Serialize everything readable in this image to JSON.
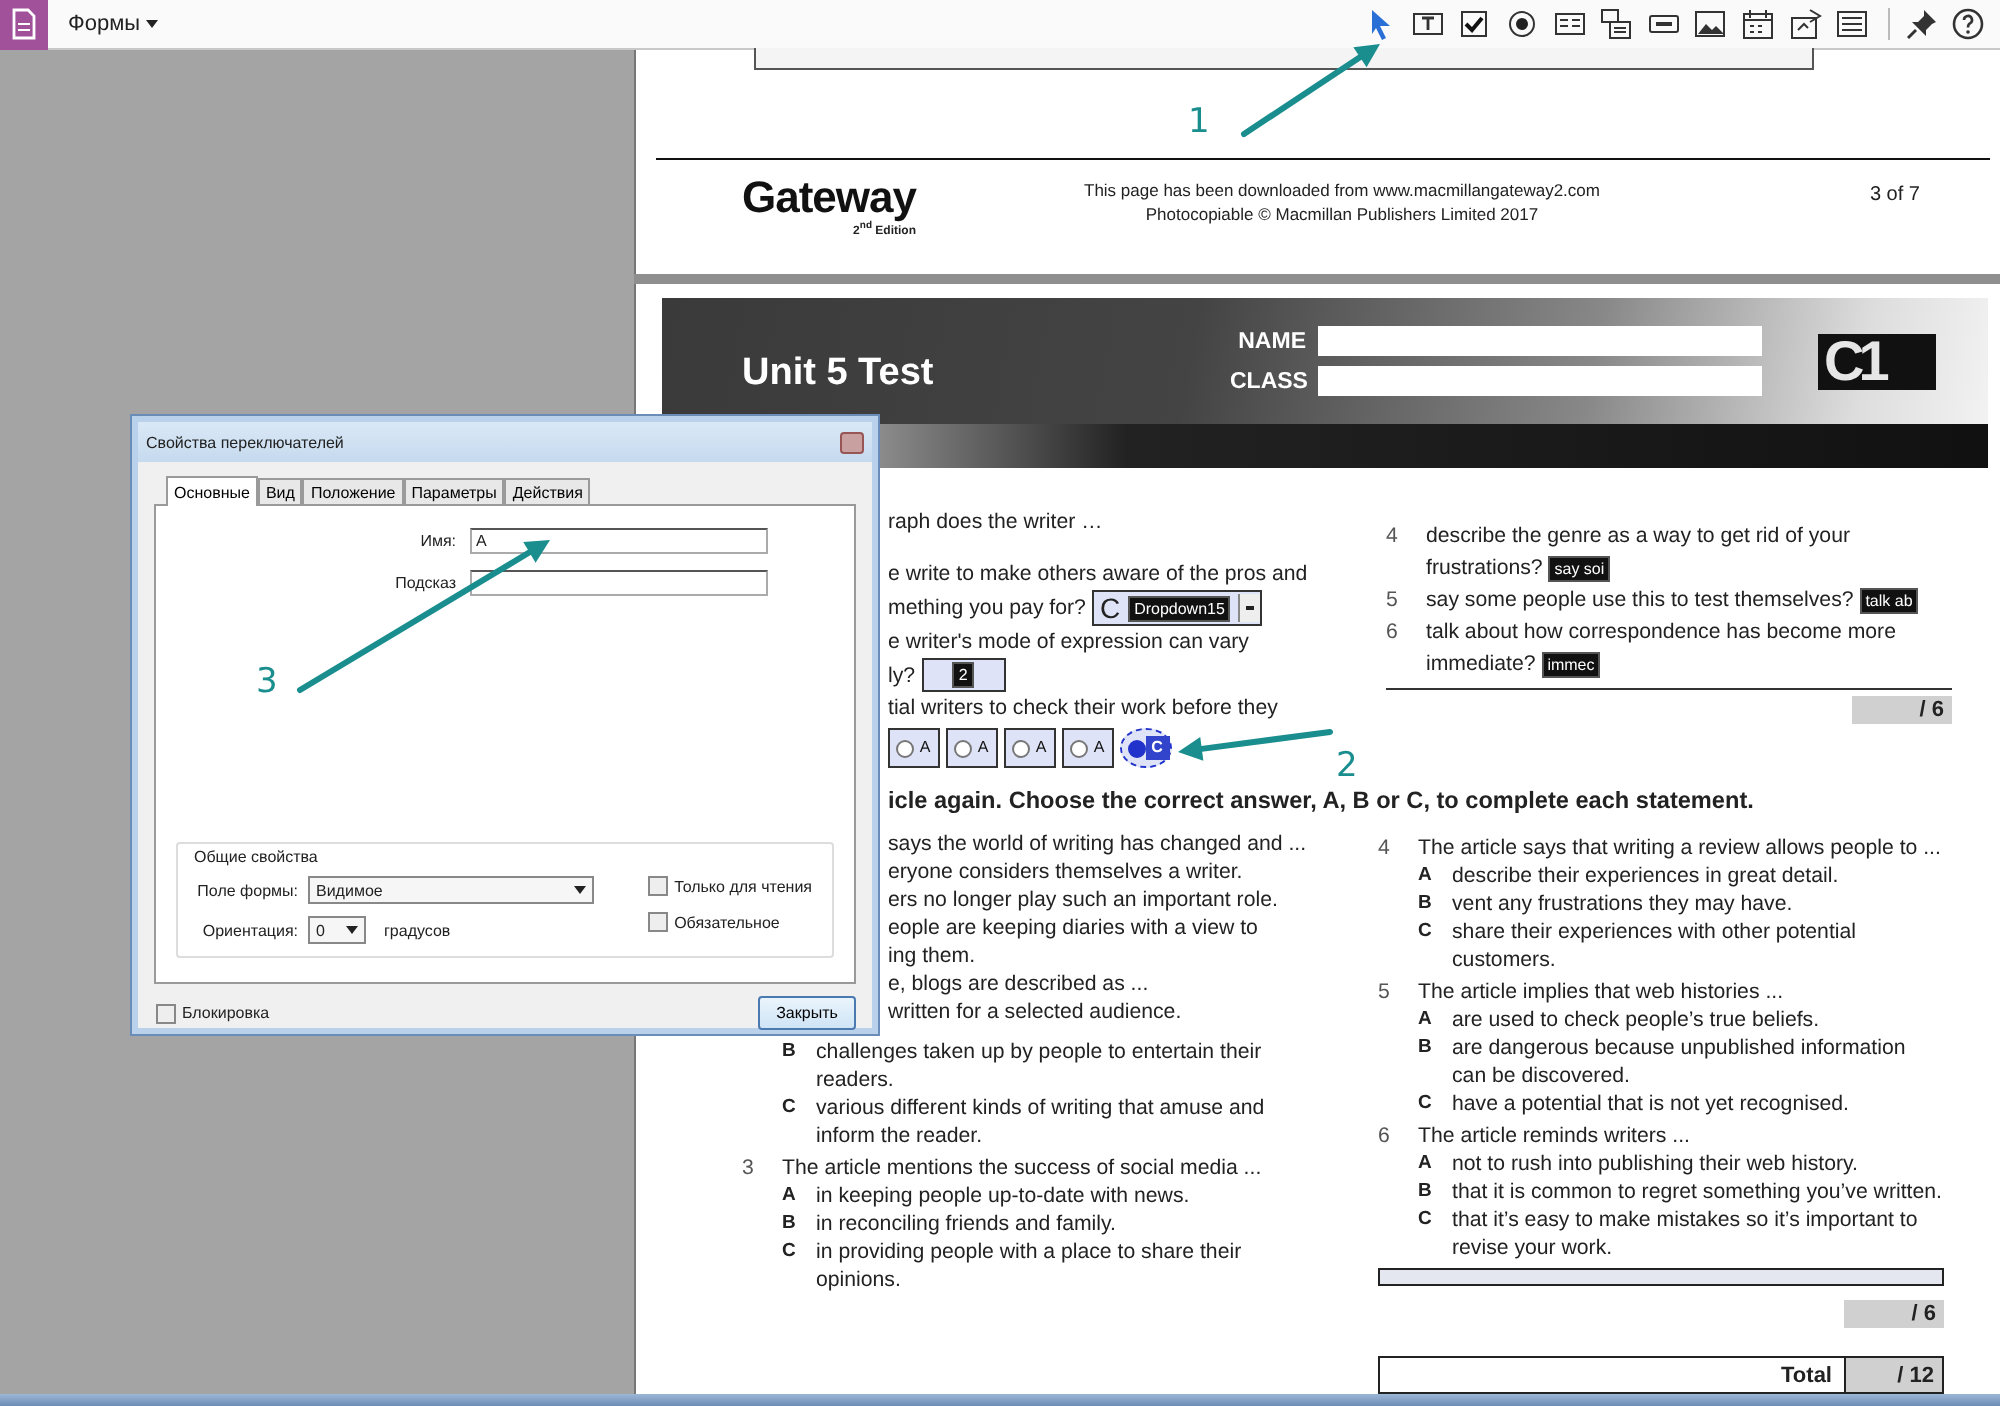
{
  "toolbar": {
    "menu": "Формы"
  },
  "page_footer": {
    "logo": "Gateway",
    "logo_edition": "2$^{nd}$ Edition",
    "lines": [
      "This page has been downloaded from www.macmillangateway2.com",
      "Photocopiable © Macmillan Publishers Limited 2017"
    ],
    "page": "3 of 7"
  },
  "test_header": {
    "title": "Unit 5 Test",
    "fields": [
      {
        "label": "NAME"
      },
      {
        "label": "CLASS"
      }
    ],
    "level": "C1"
  },
  "part1": {
    "left": [
      {
        "kind": "fragment",
        "text": "raph does the writer …"
      },
      {
        "kind": "fragment",
        "text": "e write to make others aware of the pros and"
      },
      {
        "kind": "fragment",
        "text": "mething you pay for?",
        "field": {
          "kind": "dropdown",
          "value": "C",
          "tag": "Dropdown15"
        }
      },
      {
        "kind": "fragment",
        "text": "e writer's mode of expression can vary"
      },
      {
        "kind": "fragment",
        "text": "ly?",
        "field": {
          "kind": "text",
          "value": "2"
        }
      },
      {
        "kind": "fragment",
        "text": "tial writers to check their work before they"
      },
      {
        "kind": "radios",
        "radios": [
          {
            "label": "A",
            "selected": false
          },
          {
            "label": "A",
            "selected": false
          },
          {
            "label": "A",
            "selected": false
          },
          {
            "label": "A",
            "selected": false
          },
          {
            "label": "C",
            "selected": true
          }
        ]
      }
    ],
    "right": [
      {
        "number": "4",
        "text": "describe the genre as a way to get rid of your frustrations?",
        "tag": "say soi"
      },
      {
        "number": "5",
        "text": "say some people use this to test themselves?",
        "tag": "talk ab"
      },
      {
        "number": "6",
        "text": "talk about how correspondence has become more immediate?",
        "tag": "immec"
      }
    ],
    "score": "/ 6"
  },
  "part2": {
    "heading": "icle again. Choose the correct answer, A, B or C, to complete each statement.",
    "left": [
      {
        "kind": "fragment",
        "text": "says the world of writing has changed and ..."
      },
      {
        "kind": "fragment",
        "text": "eryone considers themselves a writer."
      },
      {
        "kind": "fragment",
        "text": "ers no longer play such an important role."
      },
      {
        "kind": "fragment",
        "text": "eople are keeping diaries with a view to"
      },
      {
        "kind": "fragment",
        "text": "ing them."
      },
      {
        "kind": "fragment",
        "text": "e, blogs are described as ..."
      },
      {
        "kind": "fragment",
        "text": "written for a selected audience."
      },
      {
        "kind": "option",
        "letter": "B",
        "text": "challenges taken up by people to entertain their readers."
      },
      {
        "kind": "option",
        "letter": "C",
        "text": "various different kinds of writing that amuse and inform the reader."
      },
      {
        "kind": "question",
        "number": "3",
        "text": "The article mentions the success of social media ..."
      },
      {
        "kind": "option",
        "letter": "A",
        "text": "in keeping people up-to-date with news."
      },
      {
        "kind": "option",
        "letter": "B",
        "text": "in reconciling friends and family."
      },
      {
        "kind": "option",
        "letter": "C",
        "text": "in providing people with a place to share their opinions."
      }
    ],
    "right": [
      {
        "kind": "question",
        "number": "4",
        "text": "The article says that writing a review allows people to ..."
      },
      {
        "kind": "option",
        "letter": "A",
        "text": "describe their experiences in great detail."
      },
      {
        "kind": "option",
        "letter": "B",
        "text": "vent any frustrations they may have."
      },
      {
        "kind": "option",
        "letter": "C",
        "text": "share their experiences with other potential customers."
      },
      {
        "kind": "question",
        "number": "5",
        "text": "The article implies that web histories ..."
      },
      {
        "kind": "option",
        "letter": "A",
        "text": "are used to check people’s true beliefs."
      },
      {
        "kind": "option",
        "letter": "B",
        "text": "are dangerous because unpublished information can be discovered."
      },
      {
        "kind": "option",
        "letter": "C",
        "text": "have a potential that is not yet recognised."
      },
      {
        "kind": "question",
        "number": "6",
        "text": "The article reminds writers ..."
      },
      {
        "kind": "option",
        "letter": "A",
        "text": "not to rush into publishing their web history."
      },
      {
        "kind": "option",
        "letter": "B",
        "text": "that it is common to regret something you’ve written."
      },
      {
        "kind": "option",
        "letter": "C",
        "text": "that it’s easy to make mistakes so it’s important to revise your work."
      }
    ],
    "score": "/ 6"
  },
  "total": {
    "label": "Total",
    "score": "/ 12"
  },
  "dialog": {
    "title": "Свойства переключателей",
    "tabs": [
      {
        "label": "Основные",
        "selected": true
      },
      {
        "label": "Вид",
        "selected": false
      },
      {
        "label": "Положение",
        "selected": false
      },
      {
        "label": "Параметры",
        "selected": false
      },
      {
        "label": "Действия",
        "selected": false
      }
    ],
    "fields": [
      {
        "label": "Имя:",
        "value": "A"
      },
      {
        "label": "Подсказ"
      }
    ],
    "group": {
      "title": "Общие свойства",
      "visibility": {
        "label": "Поле формы:",
        "value": "Видимое"
      },
      "orientation": {
        "label": "Ориентация:",
        "value": "0",
        "unit": "градусов"
      },
      "checkboxes": [
        {
          "label": "Только для чтения",
          "checked": false
        },
        {
          "label": "Обязательное",
          "checked": false
        }
      ]
    },
    "lock": {
      "label": "Блокировка",
      "checked": false
    },
    "close_button": "Закрыть"
  },
  "annotations": [
    {
      "label": "1"
    },
    {
      "label": "2"
    },
    {
      "label": "3"
    }
  ]
}
